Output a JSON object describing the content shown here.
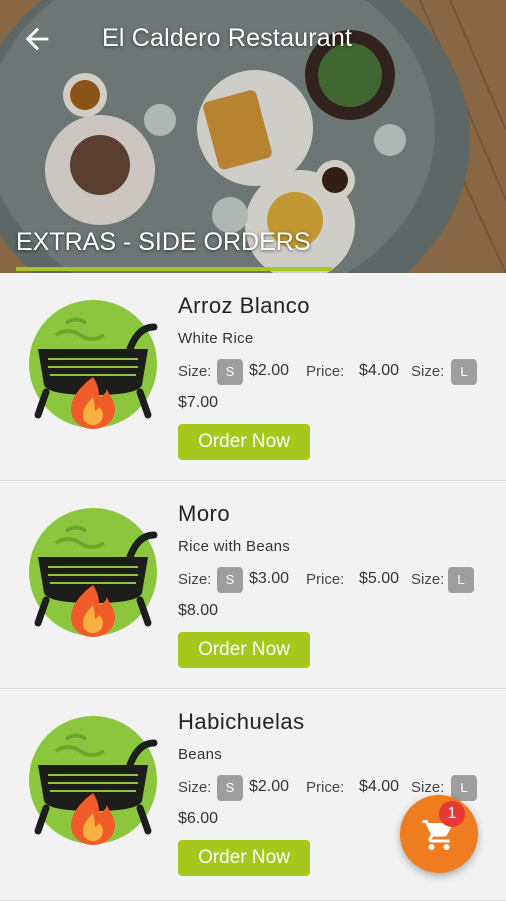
{
  "header": {
    "title": "El Caldero Restaurant",
    "back_icon": "arrow-left-icon"
  },
  "section": {
    "title": "EXTRAS - SIDE ORDERS"
  },
  "colors": {
    "accent": "#a7c71d",
    "fab": "#f07c20",
    "badge": "#e53935",
    "chip": "#9e9e9e"
  },
  "items": [
    {
      "name": "Arroz Blanco",
      "desc": "White Rice",
      "size_label": "Size:",
      "size_s": "S",
      "price_s": "$2.00",
      "price_label": "Price:",
      "price_m": "$4.00",
      "size_label2": "Size:",
      "size_l": "L",
      "price_l": "$7.00",
      "order": "Order Now"
    },
    {
      "name": "Moro",
      "desc": "Rice with Beans",
      "size_label": "Size:",
      "size_s": "S",
      "price_s": "$3.00",
      "price_label": "Price:",
      "price_m": "$5.00",
      "size_label2": "Size:",
      "size_l": "L",
      "price_l": "$8.00",
      "order": "Order Now"
    },
    {
      "name": "Habichuelas",
      "desc": "Beans",
      "size_label": "Size:",
      "size_s": "S",
      "price_s": "$2.00",
      "price_label": "Price:",
      "price_m": "$4.00",
      "size_label2": "Size:",
      "size_l": "L",
      "price_l": "$6.00",
      "order": "Order Now"
    }
  ],
  "cart": {
    "count": "1",
    "icon": "shopping-cart-icon"
  }
}
